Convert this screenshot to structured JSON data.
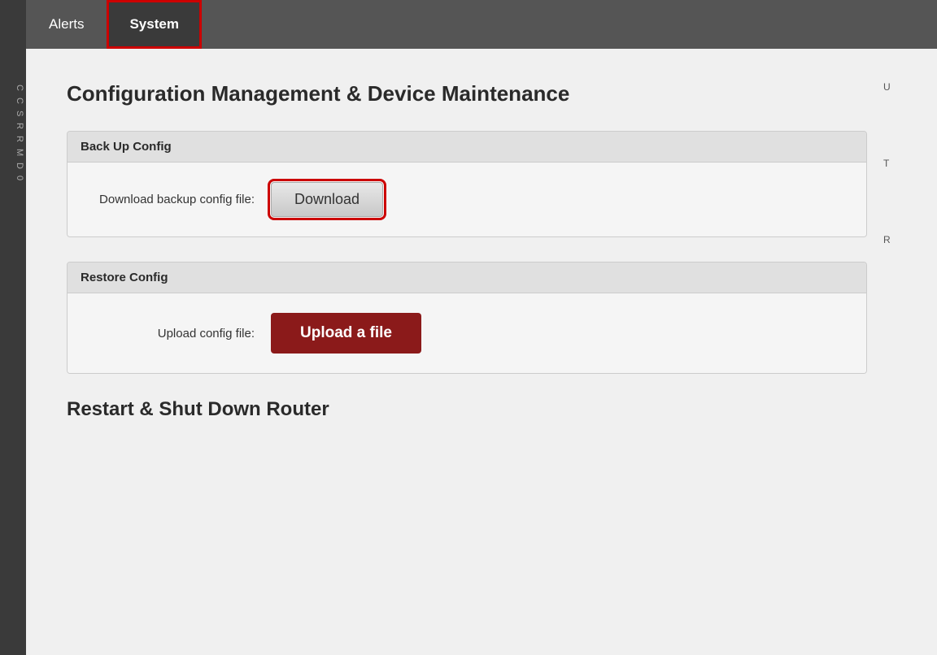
{
  "tabs": [
    {
      "label": "Alerts",
      "active": false
    },
    {
      "label": "System",
      "active": true
    }
  ],
  "section": {
    "title": "Configuration Management & Device Maintenance",
    "backup_config": {
      "header": "Back Up Config",
      "label": "Download backup config file:",
      "button_label": "Download"
    },
    "restore_config": {
      "header": "Restore Config",
      "label": "Upload config file:",
      "button_label": "Upload a file"
    },
    "restart": {
      "title": "Restart & Shut Down Router"
    }
  },
  "right_panel": {
    "item1": "U",
    "item2": "T",
    "item3": "R"
  },
  "sidebar_items": [
    "C",
    "C",
    "S",
    "R",
    "R",
    "M",
    "D",
    "0"
  ]
}
